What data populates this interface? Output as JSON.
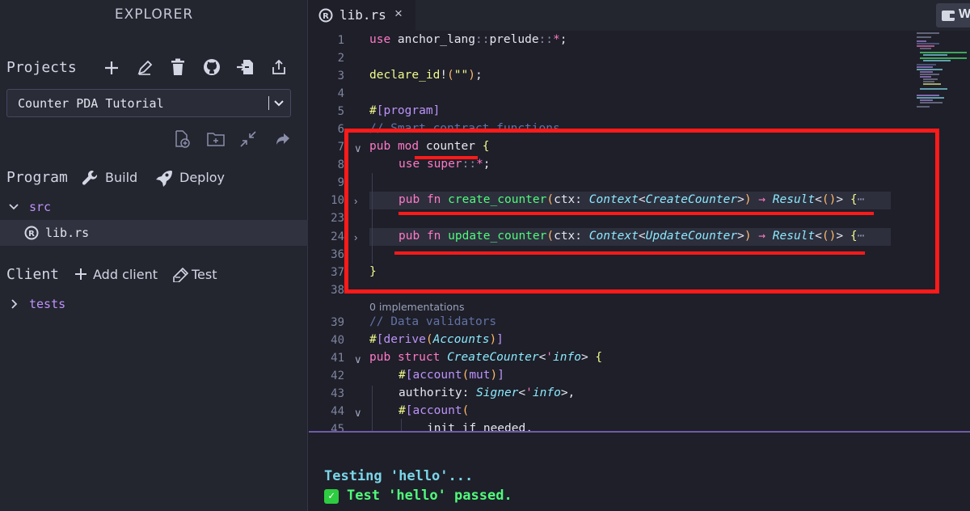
{
  "sidebar": {
    "title": "EXPLORER",
    "projects": {
      "label": "Projects",
      "selected_project": "Counter PDA Tutorial"
    },
    "program": {
      "label": "Program",
      "build_label": "Build",
      "deploy_label": "Deploy",
      "folder": "src",
      "file": "lib.rs"
    },
    "client": {
      "label": "Client",
      "add_client_label": "Add client",
      "test_label": "Test",
      "folder": "tests"
    }
  },
  "tabs": {
    "active": "lib.rs",
    "wallet_label": "W"
  },
  "editor": {
    "implementations_hint": "0 implementations",
    "lines": [
      {
        "n": "1",
        "text": "use anchor_lang::prelude::*;"
      },
      {
        "n": "2",
        "text": ""
      },
      {
        "n": "3",
        "text": "declare_id!(\"\");"
      },
      {
        "n": "4",
        "text": ""
      },
      {
        "n": "5",
        "text": "#[program]"
      },
      {
        "n": "6",
        "text": "// Smart contract functions"
      },
      {
        "n": "7",
        "text": "pub mod counter {"
      },
      {
        "n": "8",
        "text": "use super::*;"
      },
      {
        "n": "9",
        "text": ""
      },
      {
        "n": "10",
        "text": "pub fn create_counter(ctx: Context<CreateCounter>) → Result<()> {⋯"
      },
      {
        "n": "23",
        "text": ""
      },
      {
        "n": "24",
        "text": "pub fn update_counter(ctx: Context<UpdateCounter>) → Result<()> {⋯"
      },
      {
        "n": "36",
        "text": ""
      },
      {
        "n": "37",
        "text": "}"
      },
      {
        "n": "38",
        "text": ""
      },
      {
        "n": "39",
        "text": "// Data validators"
      },
      {
        "n": "40",
        "text": "#[derive(Accounts)]"
      },
      {
        "n": "41",
        "text": "pub struct CreateCounter<'info> {"
      },
      {
        "n": "42",
        "text": "#[account(mut)]"
      },
      {
        "n": "43",
        "text": "authority: Signer<'info>,"
      },
      {
        "n": "44",
        "text": "#[account("
      },
      {
        "n": "45",
        "text": "init_if_needed,"
      }
    ]
  },
  "terminal": {
    "line1": "Testing 'hello'...",
    "line2": "Test 'hello' passed."
  },
  "colors": {
    "accent_red": "#ff1a1a",
    "keyword": "#ff79c6",
    "function": "#50fa7b",
    "type": "#8be9fd"
  }
}
